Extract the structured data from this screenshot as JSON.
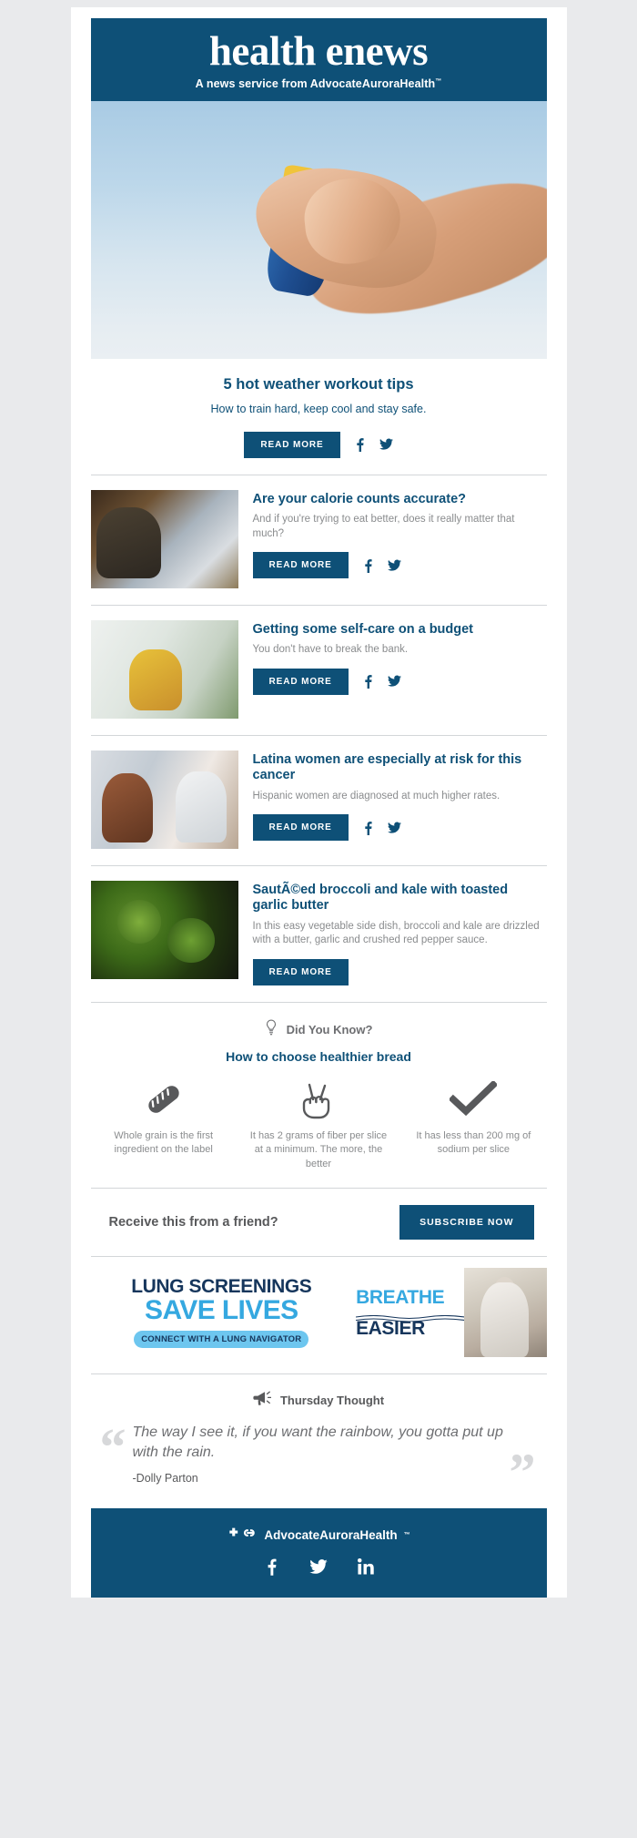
{
  "masthead": {
    "title": "health enews",
    "subtitle_prefix": "A news service from ",
    "brand": "AdvocateAuroraHealth",
    "trademark": "™"
  },
  "hero": {
    "image_alt": "sunscreen-hands-photo",
    "title": "5 hot weather workout tips",
    "description": "How to train hard, keep cool and stay safe.",
    "read_more": "READ MORE",
    "facebook_icon": "facebook-icon",
    "twitter_icon": "twitter-icon"
  },
  "articles": [
    {
      "thumb_class": "th-grocery",
      "thumb_alt": "grocery-shopper-photo",
      "title": "Are your calorie counts accurate?",
      "description": "And if you're trying to eat better, does it really matter that much?",
      "read_more": "READ MORE",
      "has_social": true
    },
    {
      "thumb_class": "th-selfcare",
      "thumb_alt": "woman-reading-at-home-photo",
      "title": "Getting some self-care on a budget",
      "description": "You don't have to break the bank.",
      "read_more": "READ MORE",
      "has_social": true
    },
    {
      "thumb_class": "th-latina",
      "thumb_alt": "patient-with-doctor-photo",
      "title": "Latina women are especially at risk for this cancer",
      "description": "Hispanic women are diagnosed at much higher rates.",
      "read_more": "READ MORE",
      "has_social": true
    },
    {
      "thumb_class": "th-broccoli",
      "thumb_alt": "broccoli-and-kale-photo",
      "title": "SautÃ©ed broccoli and kale with toasted garlic butter",
      "description": "In this easy vegetable side dish, broccoli and kale are drizzled with a butter, garlic and crushed red pepper sauce.",
      "read_more": "READ MORE",
      "has_social": false
    }
  ],
  "did_you_know": {
    "icon": "lightbulb-icon",
    "label": "Did You Know?",
    "title": "How to choose healthier bread",
    "tips": [
      {
        "icon": "baguette-bread-icon",
        "text": "Whole grain is the first ingredient on the label"
      },
      {
        "icon": "peace-hand-two-fingers-icon",
        "text": "It has 2 grams of fiber per slice at a minimum. The more, the better"
      },
      {
        "icon": "checkmark-icon",
        "text": "It has less than 200 mg of sodium per slice"
      }
    ]
  },
  "subscribe": {
    "prompt": "Receive this from a friend?",
    "button": "SUBSCRIBE NOW"
  },
  "ad": {
    "line1": "LUNG SCREENINGS",
    "line2": "SAVE LIVES",
    "pill": "CONNECT WITH A LUNG NAVIGATOR",
    "mid_line1": "BREATHE",
    "mid_line2": "EASIER",
    "image_alt": "older-woman-in-kitchen-photo"
  },
  "thursday_thought": {
    "icon": "megaphone-icon",
    "label": "Thursday Thought",
    "quote_open": "“",
    "quote_close": "”",
    "quote": "The way I see it, if you want the rainbow, you gotta put up with the rain.",
    "attribution": "-Dolly Parton"
  },
  "footer": {
    "logo_icon": "advocate-aurora-logo-icon",
    "brand": "AdvocateAuroraHealth",
    "trademark": "™",
    "socials": [
      {
        "icon": "facebook-icon",
        "name": "Facebook"
      },
      {
        "icon": "twitter-icon",
        "name": "Twitter"
      },
      {
        "icon": "linkedin-icon",
        "name": "LinkedIn"
      }
    ]
  },
  "colors": {
    "brand_blue": "#0e5077",
    "muted_gray": "#8a8c8e",
    "dark_gray": "#58595b",
    "ad_light_blue": "#35a8e0",
    "ad_navy": "#16365c"
  }
}
